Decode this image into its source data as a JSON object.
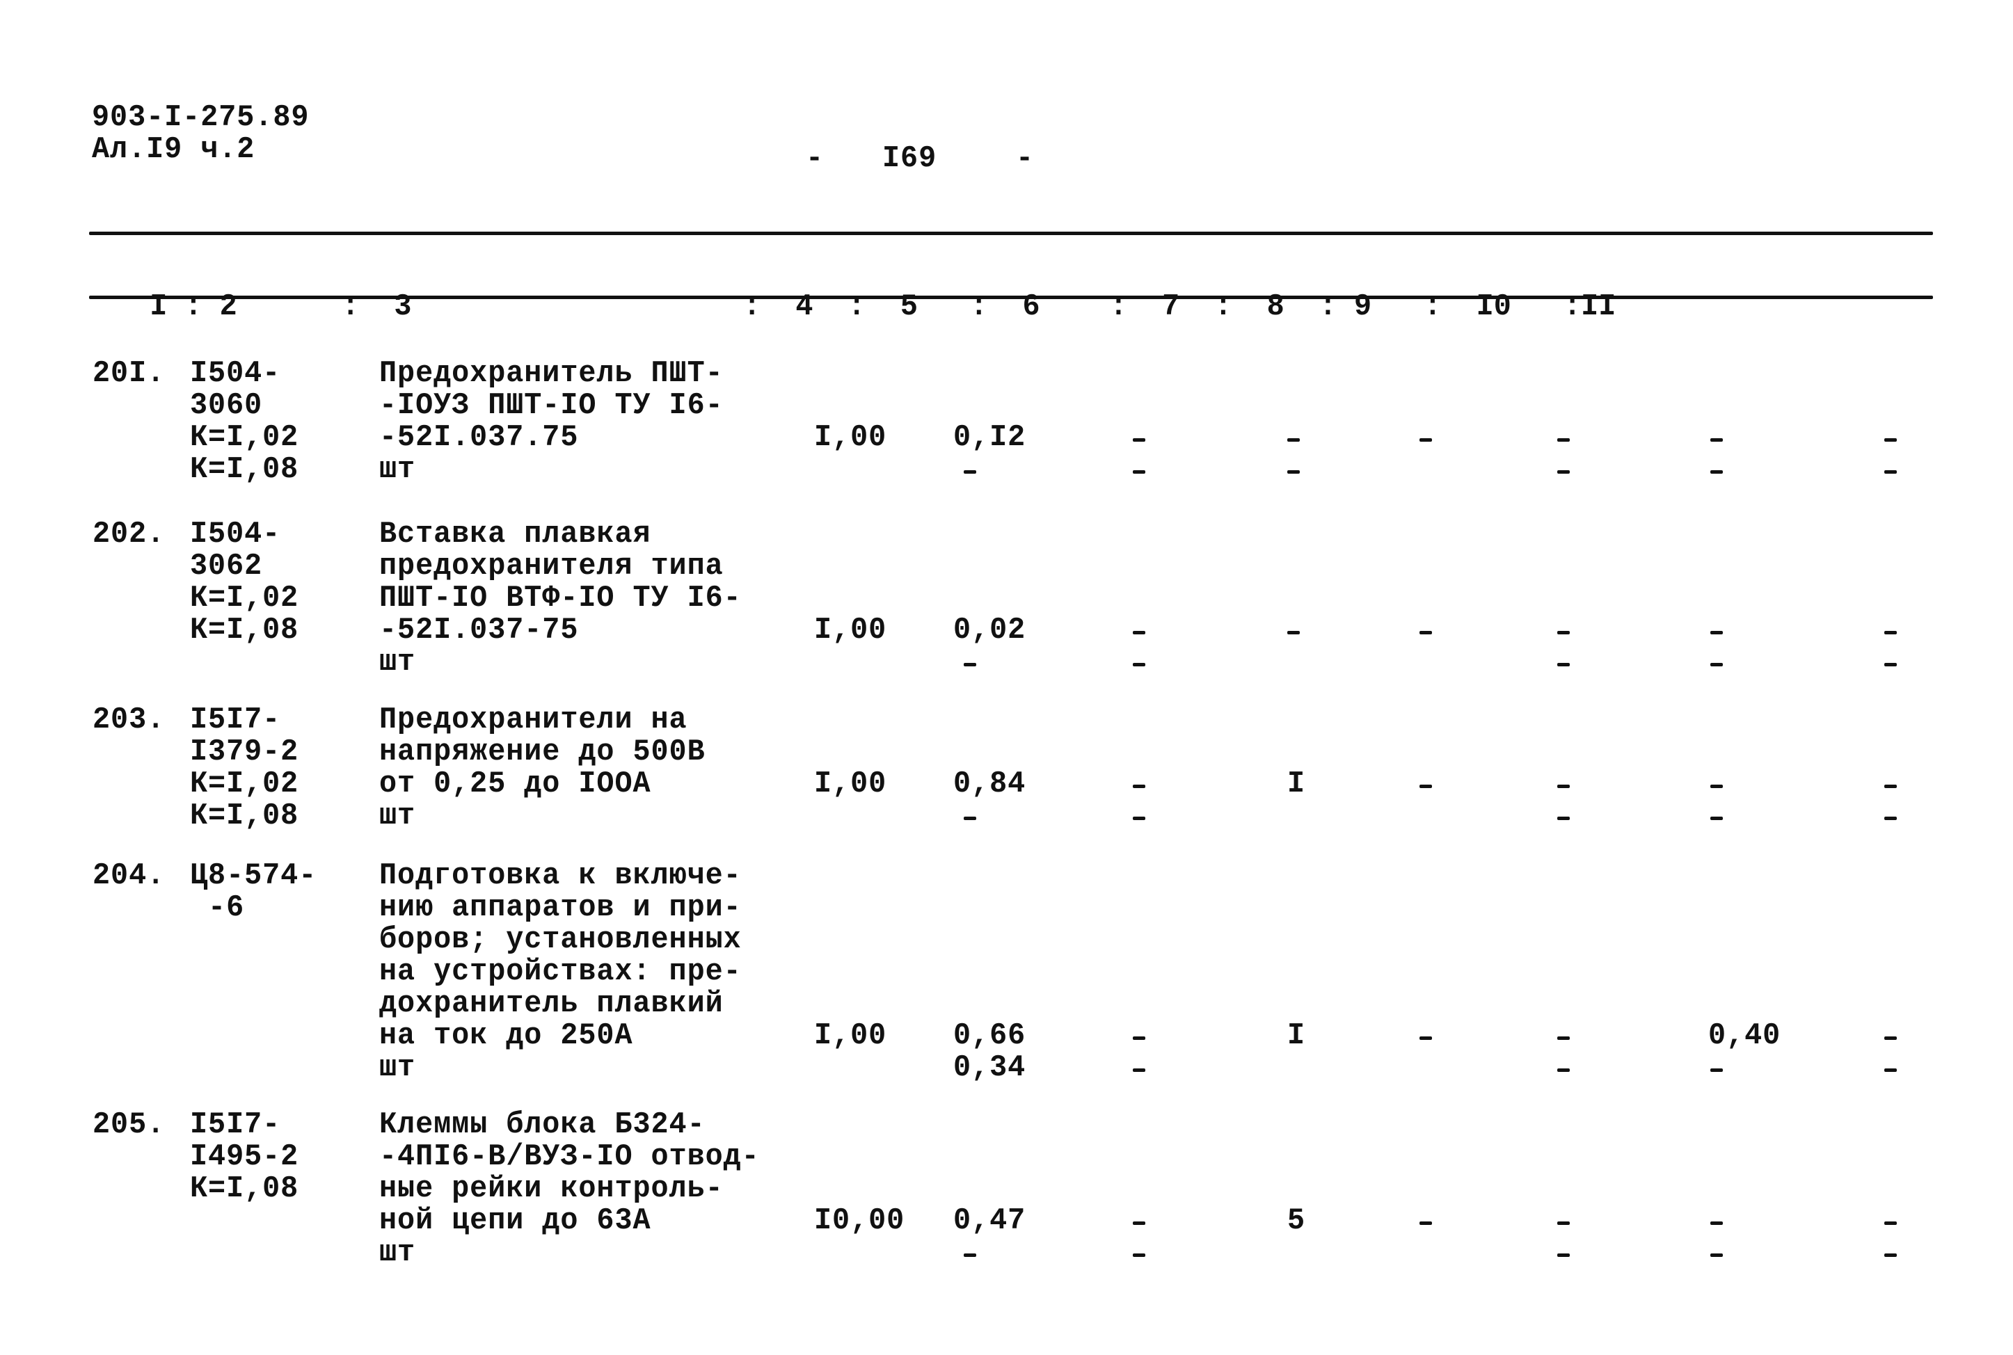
{
  "header": {
    "doc_code": "903-I-275.89",
    "sheet": "Ал.I9 ч.2",
    "page_number": "I69",
    "page_dash_left": "-",
    "page_dash_right": "-"
  },
  "table": {
    "columns": [
      "I",
      "2",
      "3",
      "4",
      "5",
      "6",
      "7",
      "8",
      "9",
      "I0",
      "II"
    ],
    "column_header_line": " I : 2      :  3                   :  4  :  5   :  6    :  7  :  8  : 9   :  I0   :II",
    "rows": [
      {
        "num": "20I.",
        "code": [
          "I504-",
          "3060",
          "К=I,02",
          "К=I,08"
        ],
        "desc": [
          "Предохранитель ПШТ-",
          "-IОУЗ ПШТ-IO ТУ I6-",
          "-52I.037.75",
          "шт"
        ],
        "c4": "I,00",
        "c5": [
          "0,I2",
          "-"
        ],
        "c6": [
          "-",
          "-"
        ],
        "c7": [
          "-",
          "-"
        ],
        "c8": [
          "-",
          ""
        ],
        "c9": [
          "-",
          "-"
        ],
        "c10": [
          "-",
          "-"
        ],
        "c11": [
          "-",
          "-"
        ]
      },
      {
        "num": "202.",
        "code": [
          "I504-",
          "3062",
          "К=I,02",
          "К=I,08"
        ],
        "desc": [
          "Вставка плавкая",
          "предохранителя типа",
          "ПШТ-IO ВТФ-IO ТУ I6-",
          "-52I.037-75",
          "шт"
        ],
        "c4": "I,00",
        "c5": [
          "0,02",
          "-"
        ],
        "c6": [
          "-",
          "-"
        ],
        "c7": [
          "-",
          ""
        ],
        "c8": [
          "-",
          ""
        ],
        "c9": [
          "-",
          "-"
        ],
        "c10": [
          "-",
          "-"
        ],
        "c11": [
          "-",
          "-"
        ]
      },
      {
        "num": "203.",
        "code": [
          "I5I7-",
          "I379-2",
          "К=I,02",
          "К=I,08"
        ],
        "desc": [
          "Предохранители на",
          "напряжение до 500В",
          "от 0,25 до IOOA",
          "шт"
        ],
        "c4": "I,00",
        "c5": [
          "0,84",
          "-"
        ],
        "c6": [
          "-",
          "-"
        ],
        "c7": [
          "I",
          ""
        ],
        "c8": [
          "-",
          ""
        ],
        "c9": [
          "-",
          "-"
        ],
        "c10": [
          "-",
          "-"
        ],
        "c11": [
          "-",
          "-"
        ]
      },
      {
        "num": "204.",
        "code": [
          "Ц8-574-",
          " -6"
        ],
        "desc": [
          "Подготовка к включе-",
          "нию аппаратов и при-",
          "боров; установленных",
          "на устройствах: пре-",
          "дохранитель плавкий",
          "на ток до 250А",
          "шт"
        ],
        "c4": "I,00",
        "c5": [
          "0,66",
          "0,34"
        ],
        "c6": [
          "-",
          "-"
        ],
        "c7": [
          "I",
          ""
        ],
        "c8": [
          "-",
          ""
        ],
        "c9": [
          "-",
          "-"
        ],
        "c10": [
          "0,40",
          "-"
        ],
        "c11": [
          "-",
          "-"
        ]
      },
      {
        "num": "205.",
        "code": [
          "I5I7-",
          "I495-2",
          "К=I,08"
        ],
        "desc": [
          "Клеммы блока Б324-",
          "-4ПI6-В/ВУЗ-IO отвод-",
          "ные рейки контроль-",
          "ной цепи до 63А",
          "шт"
        ],
        "c4": "I0,00",
        "c5": [
          "0,47",
          "-"
        ],
        "c6": [
          "-",
          "-"
        ],
        "c7": [
          "5",
          ""
        ],
        "c8": [
          "-",
          ""
        ],
        "c9": [
          "-",
          "-"
        ],
        "c10": [
          "-",
          "-"
        ],
        "c11": [
          "-",
          "-"
        ]
      }
    ]
  }
}
